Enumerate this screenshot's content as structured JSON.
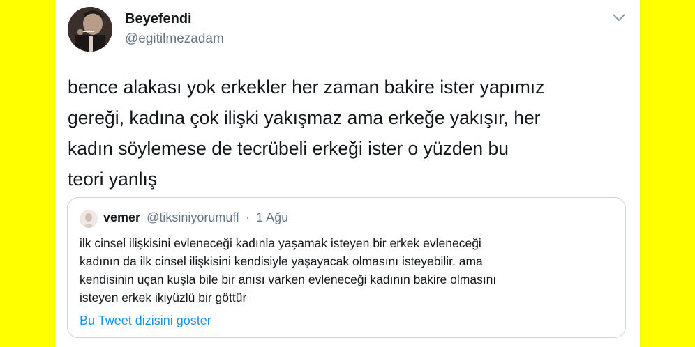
{
  "tweet": {
    "author_name": "Beyefendi",
    "author_handle": "@egitilmezadam",
    "text": "bence alakası yok erkekler her zaman bakire ister yapımız\ngereği, kadına çok ilişki yakışmaz ama erkeğe yakışır, her\nkadın söylemese de tecrübeli erkeği ister o yüzden bu\nteori yanlış"
  },
  "quoted_tweet": {
    "author_name": "vemer",
    "author_handle": "@tiksiniyorumuff",
    "separator": "·",
    "date": "1 Ağu",
    "text": "ilk cinsel ilişkisini evleneceği kadınla yaşamak isteyen bir erkek evleneceği\nkadının da ilk cinsel ilişkisini kendisiyle yaşayacak olmasını isteyebilir. ama\nkendisinin uçan kuşla bile bir anısı varken evleneceği kadının bakire olmasını\nisteyen erkek ikiyüzlü bir göttür",
    "thread_link": "Bu Tweet dizisini göster"
  },
  "colors": {
    "background": "#ffff00",
    "link": "#1b95e0",
    "muted": "#657786",
    "text": "#14171a"
  },
  "icons": [
    "avatar-photo",
    "chevron-down-icon",
    "quoted-avatar-photo"
  ]
}
